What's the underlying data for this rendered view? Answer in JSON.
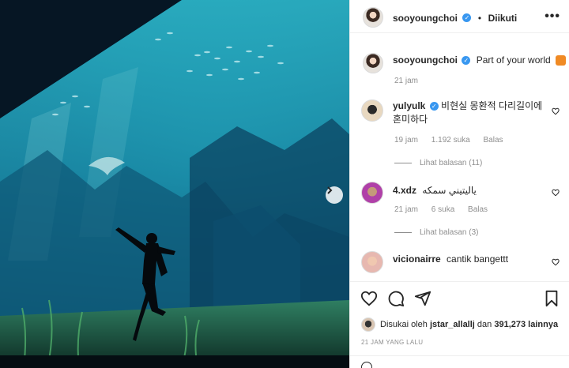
{
  "post": {
    "author": "sooyoungchoi",
    "follow_status": "Diikuti",
    "dot": "•",
    "more": "•••",
    "caption": "Part of your world",
    "caption_time": "21 jam",
    "likes_by": "Disukai oleh",
    "likes_user": "jstar_allallj",
    "likes_and": "dan",
    "likes_count": "391,273",
    "likes_others": "lainnya",
    "post_time": "21 JAM YANG LALU"
  },
  "comments": [
    {
      "user": "yulyulk",
      "verified": true,
      "text": "비현실 몽환적 다리길이에 혼미하다",
      "time": "19 jam",
      "likes": "1.192 suka",
      "reply": "Balas",
      "view_replies": "Lihat balasan (11)"
    },
    {
      "user": "4.xdz",
      "verified": false,
      "text": "ياليتيني سمكه",
      "time": "21 jam",
      "likes": "6 suka",
      "reply": "Balas",
      "view_replies": "Lihat balasan (3)"
    },
    {
      "user": "vicionairre",
      "verified": false,
      "text": "cantik bangettt",
      "time": "",
      "likes": "",
      "reply": "",
      "view_replies": ""
    }
  ],
  "icons": {
    "verified": "checkmark",
    "heart": "heart-icon",
    "comment": "comment-icon",
    "share": "share-icon",
    "save": "bookmark-icon",
    "next": "chevron-right-icon"
  },
  "colors": {
    "verified_blue": "#3897f0",
    "meta_gray": "#8e8e8e",
    "text": "#262626"
  }
}
